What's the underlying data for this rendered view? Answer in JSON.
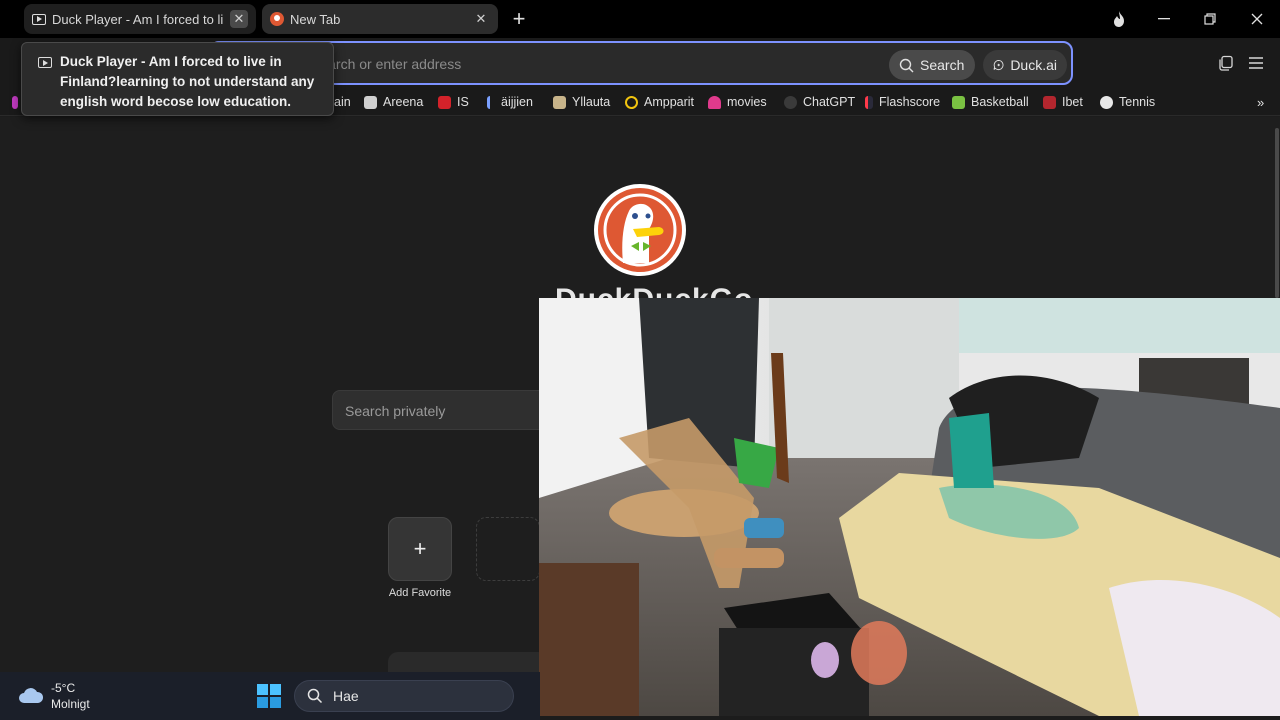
{
  "tabs": [
    {
      "title": "Duck Player - Am I forced to li",
      "icon": "play-icon",
      "active": false
    },
    {
      "title": "New Tab",
      "icon": "duckduckgo-icon",
      "active": true
    }
  ],
  "address": {
    "placeholder": "Search or enter address",
    "search_label": "Search",
    "duckai_label": "Duck.ai"
  },
  "tooltip": {
    "text": "Duck Player - Am I forced to live in Finland?learning to not understand any english word becose low education."
  },
  "bookmarks": [
    {
      "label": "ain",
      "color": "#888888"
    },
    {
      "label": "Areena",
      "color": "#d0d0d0"
    },
    {
      "label": "IS",
      "color": "#d3222a"
    },
    {
      "label": "äijjien",
      "color": "#7aa0ff"
    },
    {
      "label": "Yllauta",
      "color": "#c8b48a"
    },
    {
      "label": "Ampparit",
      "color": "#f1c40f"
    },
    {
      "label": "movies",
      "color": "#e03a8c"
    },
    {
      "label": "ChatGPT",
      "color": "#3a3a3a"
    },
    {
      "label": "Flashscore",
      "color": "#2a2a3a"
    },
    {
      "label": "Basketball",
      "color": "#7ac142"
    },
    {
      "label": "Ibet",
      "color": "#b3262e"
    },
    {
      "label": "Tennis",
      "color": "#e8e8e8"
    }
  ],
  "page": {
    "wordmark": "DuckDuckGo",
    "search_placeholder": "Search privately",
    "add_favorite_label": "Add Favorite",
    "add_symbol": "+"
  },
  "taskbar": {
    "temperature": "-5°C",
    "weather": "Molnigt",
    "search_text": "Hae"
  },
  "colors": {
    "accent": "#7d92ff",
    "ddg_orange": "#de5833"
  }
}
